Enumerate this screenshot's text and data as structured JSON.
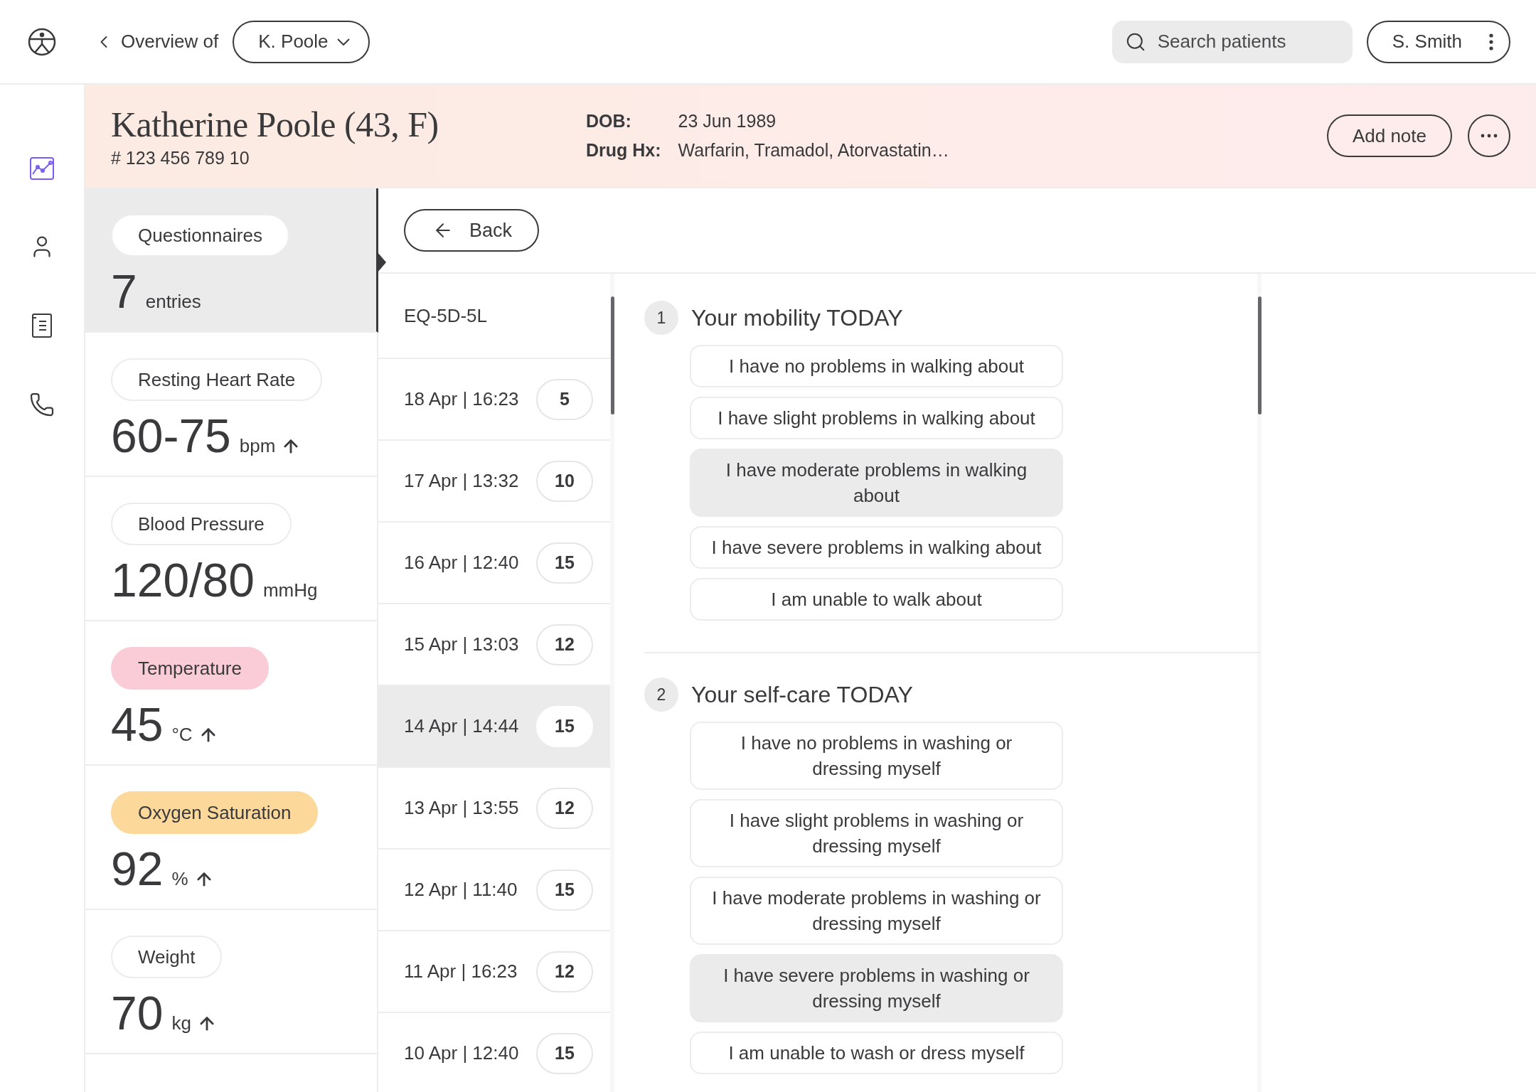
{
  "top_bar": {
    "back_label": "Overview of",
    "patient_select": "K. Poole",
    "search": {
      "placeholder": "Search patients"
    },
    "user": "S. Smith"
  },
  "nav": [
    {
      "selected": true
    },
    {
      "selected": false
    },
    {
      "selected": false
    },
    {
      "selected": false
    }
  ],
  "patient": {
    "name": "Katherine Poole (43, F)",
    "number": "# 123 456 789 10",
    "fields": [
      {
        "label": "DOB:",
        "value": "23 Jun 1989"
      },
      {
        "label": "Drug Hx:",
        "value": "Warfarin, Tramadol, Atorvastatin…"
      }
    ],
    "add_note": "Add note"
  },
  "metrics": [
    {
      "label": "Questionnaires",
      "value": "7",
      "unit": "entries",
      "rising": false,
      "selected": true
    },
    {
      "label": "Resting Heart Rate",
      "value": "60-75",
      "unit": "bpm",
      "rising": true,
      "selected": false
    },
    {
      "label": "Blood Pressure",
      "value": "120/80",
      "unit": "mmHg",
      "rising": false,
      "selected": false
    },
    {
      "label": "Temperature",
      "value": "45",
      "unit": "°C",
      "rising": true,
      "color": "#f9ccd8",
      "selected": false
    },
    {
      "label": "Oxygen Saturation",
      "value": "92",
      "unit": "%",
      "rising": true,
      "color": "#fcd99b",
      "selected": false
    },
    {
      "label": "Weight",
      "value": "70",
      "unit": "kg",
      "rising": true,
      "selected": false
    }
  ],
  "back": "Back",
  "questionnaire": {
    "title": "EQ-5D-5L",
    "entries": [
      {
        "date": "18 Apr | 16:23",
        "score": "5",
        "selected": false
      },
      {
        "date": "17 Apr | 13:32",
        "score": "10",
        "selected": false
      },
      {
        "date": "16 Apr | 12:40",
        "score": "15",
        "selected": false
      },
      {
        "date": "15 Apr | 13:03",
        "score": "12",
        "selected": false
      },
      {
        "date": "14 Apr | 14:44",
        "score": "15",
        "selected": true
      },
      {
        "date": "13 Apr | 13:55",
        "score": "12",
        "selected": false
      },
      {
        "date": "12 Apr | 11:40",
        "score": "15",
        "selected": false
      },
      {
        "date": "11 Apr | 16:23",
        "score": "12",
        "selected": false
      },
      {
        "date": "10 Apr | 12:40",
        "score": "15",
        "selected": false
      }
    ]
  },
  "questions": [
    {
      "number": "1",
      "title": "Your mobility TODAY",
      "options": [
        {
          "text": "I have no problems in walking about",
          "selected": false
        },
        {
          "text": "I have slight problems in walking about",
          "selected": false
        },
        {
          "text": "I have moderate problems in walking about",
          "selected": true
        },
        {
          "text": "I have severe problems in walking about",
          "selected": false
        },
        {
          "text": "I am unable to walk about",
          "selected": false
        }
      ]
    },
    {
      "number": "2",
      "title": "Your self-care TODAY",
      "options": [
        {
          "text": "I have no problems in washing or dressing myself",
          "selected": false
        },
        {
          "text": "I have slight problems in washing or dressing myself",
          "selected": false
        },
        {
          "text": "I have moderate problems in washing or dressing myself",
          "selected": false
        },
        {
          "text": "I have severe problems in washing or dressing myself",
          "selected": true
        },
        {
          "text": "I am unable to wash or dress myself",
          "selected": false
        }
      ]
    }
  ]
}
